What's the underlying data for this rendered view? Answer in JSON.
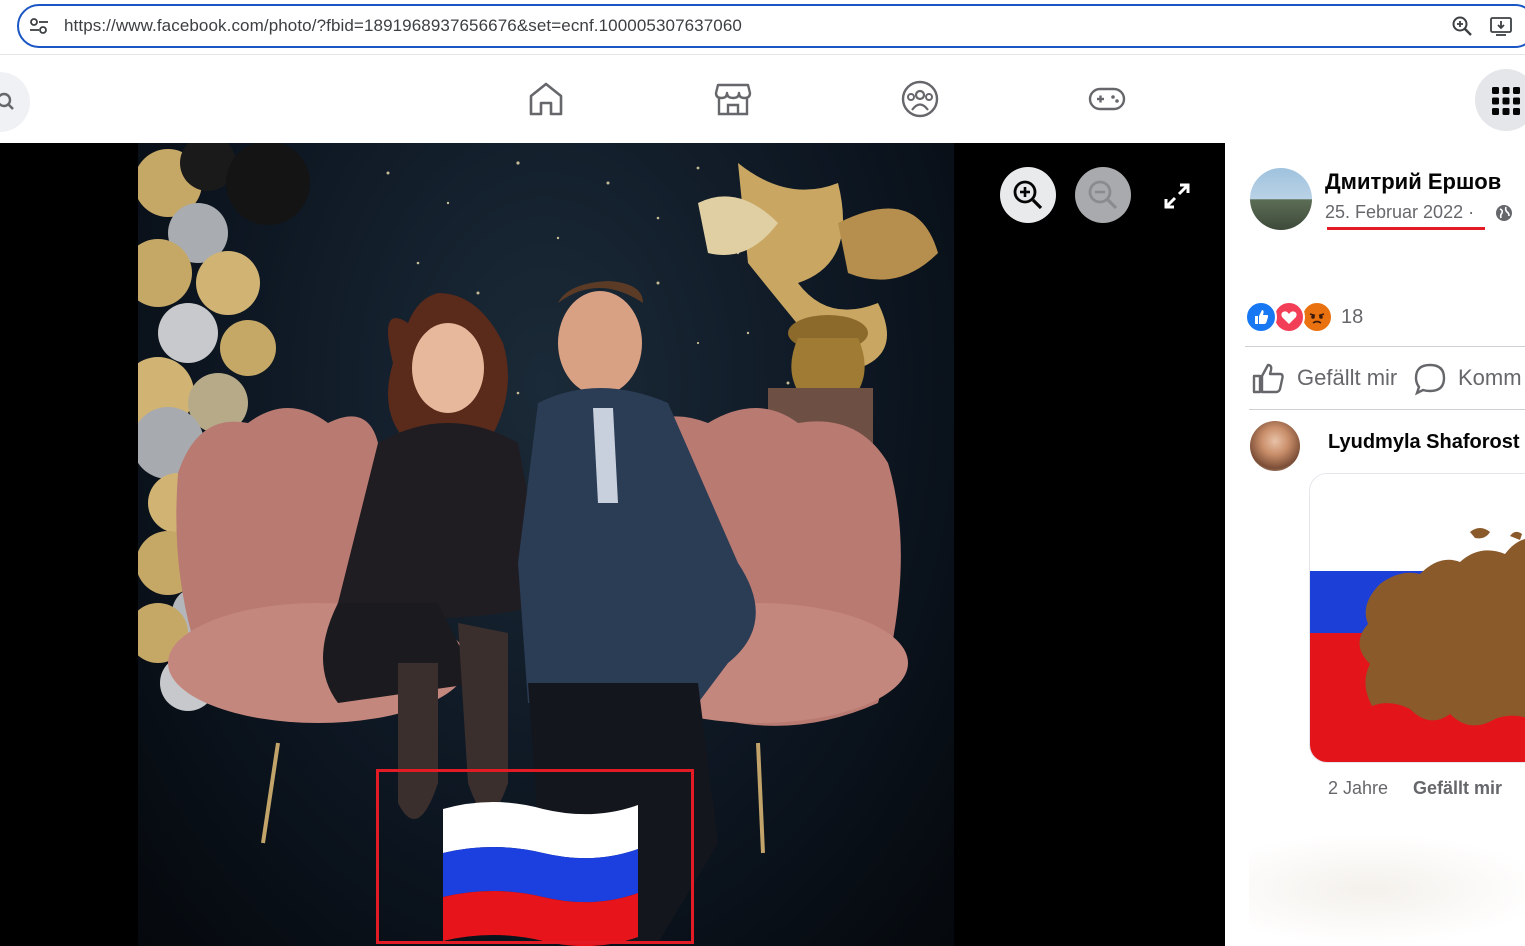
{
  "browser": {
    "url": "https://www.facebook.com/photo/?fbid=1891968937656676&set=ecnf.100005307637060",
    "icons": [
      "tune-icon",
      "zoom-icon",
      "install-icon"
    ]
  },
  "nav": {
    "icons": [
      "search-icon",
      "home-icon",
      "marketplace-icon",
      "groups-icon",
      "gaming-icon",
      "menu-grid-icon"
    ]
  },
  "viewer": {
    "controls": [
      "zoom-in-icon",
      "zoom-out-icon",
      "fullscreen-icon"
    ]
  },
  "post": {
    "author": "Дмитрий Ершов",
    "date": "25. Februar 2022",
    "separator": "·",
    "reaction_count": "18",
    "actions": {
      "like": "Gefällt mir",
      "comment": "Komm"
    }
  },
  "comment": {
    "author": "Lyudmyla Shaforost",
    "age": "2 Jahre",
    "like": "Gefällt mir"
  },
  "colors": {
    "accent": "#1a56c4",
    "highlight": "#e21b24",
    "flag_white": "#ffffff",
    "flag_blue": "#1c3fe0",
    "flag_red": "#e8141b"
  }
}
